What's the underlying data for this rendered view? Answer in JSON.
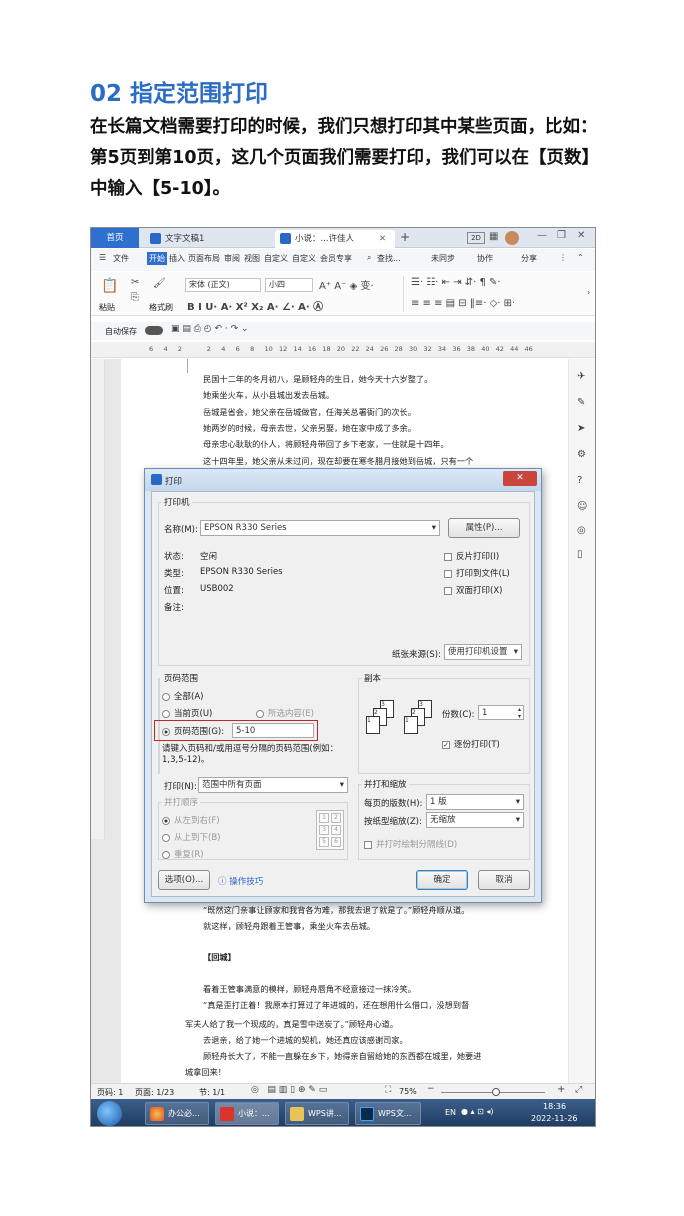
{
  "heading": "02 指定范围打印",
  "description": "在长篇文档需要打印的时候，我们只想打印其中某些页面，比如：第5页到第10页，这几个页面我们需要打印，我们可以在【页数】中输入【5-10】。",
  "tabs": {
    "home": "首页",
    "doc1": "文字文稿1",
    "doc2": "小说：...许佳人",
    "add": "+"
  },
  "titlebar": {
    "user_initials": "2D"
  },
  "menu": {
    "file": "文件",
    "start": "开始",
    "insert": "插入",
    "layout": "页面布局",
    "review": "审阅",
    "view": "视图",
    "custom1": "自定义",
    "custom2": "自定义",
    "member": "会员专享",
    "search": "查找...",
    "sync": "未同步",
    "collab": "协作",
    "share": "分享"
  },
  "ribbon": {
    "paste": "粘贴",
    "format_painter": "格式刷",
    "font": "宋体 (正文)",
    "size": "小四"
  },
  "quickbar": {
    "autosave": "自动保存"
  },
  "ruler": {
    "ticks": [
      "6",
      "4",
      "2",
      "",
      "2",
      "4",
      "6",
      "8",
      "10",
      "12",
      "14",
      "16",
      "18",
      "20",
      "22",
      "24",
      "26",
      "28",
      "30",
      "32",
      "34",
      "36",
      "38",
      "40",
      "42",
      "44",
      "46"
    ]
  },
  "doc_lines_top": [
    "民国十二年的冬月初八，是顾轻舟的生日，她今天十六岁整了。",
    "她乘坐火车，从小县城出发去岳城。",
    "岳城是省会，她父亲在岳城做官，任海关总署衙门的次长。",
    "她两岁的时候，母亲去世，父亲另娶，她在家中成了多余。",
    "母亲忠心耿耿的仆人，将顾轻舟带回了乡下老家，一住就是十四年。",
    "这十四年里，她父亲从未过问，现在却要在寒冬腊月接她到岳城，只有一个"
  ],
  "doc_lines_bottom": [
    "“既然这门亲事让顾家和我背各为难，那我去退了就是了。”顾轻舟顺从道。",
    "就这样，顾轻舟跟着王管事，乘坐火车去岳城。",
    "【回城】",
    "看着王管事满意的模样，顾轻舟唇角不经意接过一抹冷笑。",
    "“真是歪打正着！我原本打算过了年进城的，还在想用什么借口，没想到督",
    "军夫人给了我一个现成的，真是雪中送炭了。”顾轻舟心道。",
    "去退亲，给了她一个进城的契机，她还真应该感谢司家。",
    "顾轻舟长大了，不能一直躲在乡下，她得亲自留给她的东西都在城里，她要进",
    "城拿回来！"
  ],
  "dialog": {
    "title": "打印",
    "printer_group": "打印机",
    "name_label": "名称(M):",
    "printer_name": "EPSON R330 Series",
    "properties": "属性(P)...",
    "status_label": "状态:",
    "status_value": "空闲",
    "type_label": "类型:",
    "type_value": "EPSON R330 Series",
    "location_label": "位置:",
    "location_value": "USB002",
    "comment_label": "备注:",
    "reverse": "反片打印(I)",
    "to_file": "打印到文件(L)",
    "duplex": "双面打印(X)",
    "paper_source_label": "纸张来源(S):",
    "paper_source_value": "使用打印机设置",
    "range_group": "页码范围",
    "all": "全部(A)",
    "current": "当前页(U)",
    "selection": "所选内容(E)",
    "pages": "页码范围(G):",
    "pages_value": "5-10",
    "pages_hint": "请键入页码和/或用逗号分隔的页码范围(例如：1,3,5-12)。",
    "copies_group": "副本",
    "copies_label": "份数(C):",
    "copies_value": "1",
    "collate": "逐份打印(T)",
    "print_label": "打印(N):",
    "print_value": "范围中所有页面",
    "merge_order": "并打顺序",
    "ltr": "从左到右(F)",
    "ttb": "从上到下(B)",
    "repeat": "重复(R)",
    "scale_group": "并打和缩放",
    "per_sheet_label": "每页的版数(H):",
    "per_sheet_value": "1 版",
    "scale_label": "按纸型缩放(Z):",
    "scale_value": "无缩放",
    "draw_divider": "并打时绘制分隔线(D)",
    "options": "选项(O)...",
    "tips": "操作技巧",
    "ok": "确定",
    "cancel": "取消",
    "preview_numbers": [
      "1",
      "2",
      "3",
      "4",
      "5",
      "6"
    ]
  },
  "statusbar": {
    "page": "页码: 1",
    "pages": "页面: 1/23",
    "section": "节: 1/1",
    "zoom": "75%"
  },
  "taskbar": {
    "t1": "办公必...",
    "t2": "小说：...",
    "t3": "WPS讲...",
    "t4": "WPS文...",
    "lang": "EN",
    "time": "18:36",
    "date": "2022-11-26"
  }
}
